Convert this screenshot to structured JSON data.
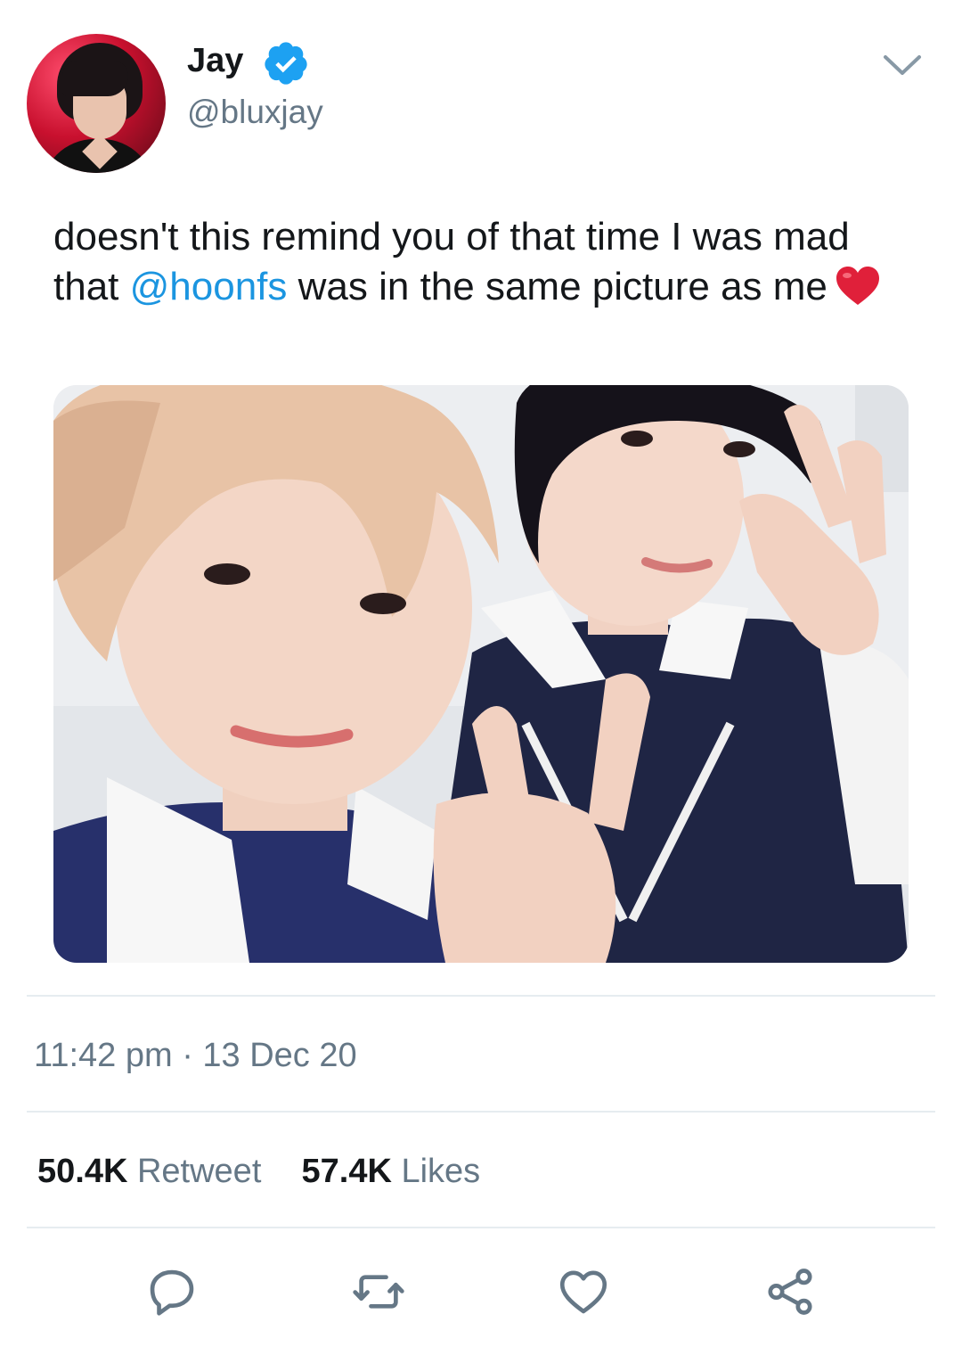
{
  "user": {
    "display_name": "Jay",
    "handle": "@bluxjay",
    "verified": true
  },
  "tweet": {
    "text_before": "doesn't this remind you of that time I was mad that ",
    "mention": "@hoonfs",
    "text_after": " was in the same picture as me",
    "emoji": "heart-emoji"
  },
  "meta": {
    "time": "11:42 pm",
    "separator": "·",
    "date": "13 Dec 20"
  },
  "stats": {
    "retweets_count": "50.4K",
    "retweets_label": "Retweet",
    "likes_count": "57.4K",
    "likes_label": "Likes"
  },
  "actions": [
    "reply-icon",
    "retweet-icon",
    "like-icon",
    "share-icon"
  ],
  "colors": {
    "text": "#14171a",
    "secondary": "#657786",
    "accent": "#1b95e0",
    "verified": "#1da1f2",
    "divider": "#e6ecf0",
    "heart": "#e0245e"
  }
}
